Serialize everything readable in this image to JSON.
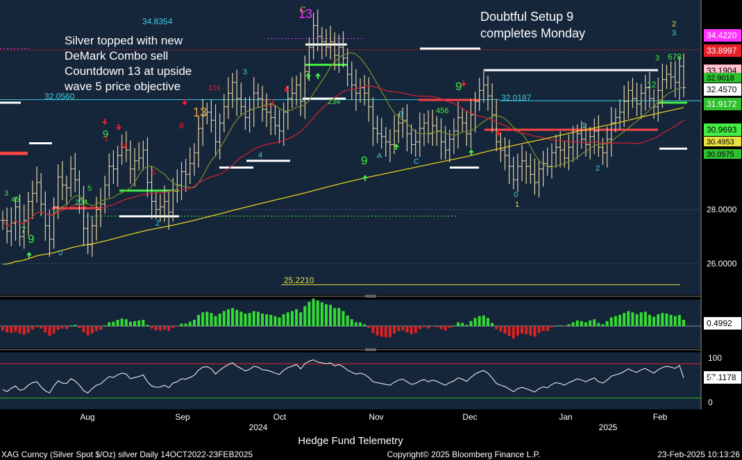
{
  "chart_data": {
    "type": "bar",
    "subtype": "ohlc-price-chart-with-histogram-and-oscillator",
    "background": "#15253a",
    "price_axis": {
      "ticks": [
        26.0,
        28.0
      ],
      "tick_labels": [
        "26.0000",
        "28.0000"
      ],
      "grid": true
    },
    "x_axis": {
      "month_labels": [
        "Aug",
        "Sep",
        "Oct",
        "Nov",
        "Dec",
        "Jan",
        "Feb"
      ],
      "year_labels": [
        "2024",
        "2025"
      ]
    },
    "annotations": {
      "left_text": [
        "Silver topped with new",
        "DeMark Combo sell",
        "Countdown 13 at upside",
        "wave 5 price objective"
      ],
      "right_text": [
        "Doubtful Setup 9",
        "completes Monday"
      ],
      "level_labels": [
        "34.8354",
        "32.0560",
        "32.0187",
        "25.2210"
      ]
    },
    "price_tags": [
      {
        "value": "34.4220",
        "color": "#ff33ff"
      },
      {
        "value": "33.8997",
        "color": "#e8202a"
      },
      {
        "value": "33.1904",
        "color": "#ffc0d0"
      },
      {
        "value": "32.4570",
        "color": "#ffffff"
      },
      {
        "value": "31.9172",
        "color": "#2fbf2f"
      },
      {
        "value": "30.9693",
        "color": "#44ee44"
      }
    ],
    "overlapped_tags": [
      "32.9018",
      "30.4953",
      "30.0575"
    ],
    "histogram": {
      "tag": "0.4992",
      "positive_color": "#33dd33",
      "negative_color": "#dd2222"
    },
    "oscillator": {
      "ticks": [
        "100",
        "50",
        "0"
      ],
      "tag": "57.1178",
      "upper_band": 90,
      "lower_band": 10
    },
    "series": [
      {
        "name": "close",
        "color": "#ffffff"
      },
      {
        "name": "ma-short",
        "color": "#7a8a2a"
      },
      {
        "name": "ma-mid",
        "color": "#cc2233"
      },
      {
        "name": "ma-long",
        "color": "#e8d020"
      }
    ],
    "close_series": [
      27.6,
      27.2,
      27.5,
      28.1,
      27.0,
      27.6,
      28.3,
      28.6,
      29.0,
      28.2,
      27.4,
      26.9,
      28.1,
      29.2,
      28.9,
      28.8,
      29.5,
      29.1,
      28.4,
      27.3,
      26.7,
      27.4,
      28.0,
      28.2,
      28.9,
      29.6,
      29.5,
      30.0,
      30.3,
      30.2,
      29.5,
      29.8,
      29.9,
      30.2,
      29.0,
      28.3,
      28.0,
      28.1,
      28.3,
      27.9,
      28.7,
      28.9,
      29.4,
      29.3,
      29.7,
      30.1,
      31.0,
      31.5,
      31.6,
      31.3,
      30.5,
      31.2,
      31.8,
      32.3,
      32.7,
      32.1,
      31.8,
      31.4,
      31.7,
      32.3,
      32.1,
      31.7,
      31.6,
      31.4,
      31.1,
      30.9,
      31.6,
      32.1,
      32.3,
      32.6,
      32.0,
      33.1,
      34.0,
      34.8,
      34.4,
      34.2,
      34.0,
      34.2,
      33.7,
      34.0,
      33.6,
      33.0,
      32.6,
      32.3,
      32.5,
      32.3,
      31.8,
      31.0,
      30.8,
      30.7,
      30.5,
      30.4,
      30.9,
      31.2,
      31.3,
      30.8,
      30.4,
      30.5,
      31.0,
      31.2,
      30.8,
      31.1,
      30.9,
      30.5,
      30.2,
      30.6,
      30.9,
      31.4,
      31.2,
      30.8,
      31.5,
      32.0,
      32.4,
      32.6,
      32.2,
      31.5,
      30.5,
      30.2,
      30.0,
      29.6,
      29.1,
      29.6,
      29.8,
      29.6,
      29.3,
      29.0,
      29.5,
      29.7,
      29.6,
      30.1,
      30.3,
      30.2,
      29.9,
      30.3,
      30.5,
      30.8,
      30.6,
      30.4,
      30.7,
      30.9,
      30.3,
      30.1,
      30.6,
      31.2,
      31.4,
      31.6,
      32.0,
      32.4,
      32.1,
      31.9,
      32.3,
      32.5,
      32.1,
      31.8,
      32.4,
      32.8,
      33.0,
      32.9,
      32.7,
      33.3,
      32.5
    ],
    "oscillator_series": [
      30,
      25,
      33,
      38,
      28,
      31,
      40,
      46,
      48,
      36,
      27,
      22,
      38,
      50,
      45,
      44,
      55,
      50,
      40,
      27,
      22,
      32,
      40,
      43,
      52,
      60,
      58,
      64,
      68,
      66,
      55,
      58,
      60,
      64,
      48,
      38,
      35,
      36,
      40,
      34,
      45,
      48,
      55,
      54,
      58,
      63,
      75,
      82,
      83,
      78,
      66,
      75,
      82,
      88,
      92,
      84,
      79,
      73,
      77,
      84,
      82,
      76,
      75,
      72,
      68,
      65,
      75,
      81,
      84,
      88,
      78,
      90,
      96,
      99,
      94,
      92,
      90,
      92,
      85,
      88,
      83,
      75,
      70,
      66,
      68,
      65,
      58,
      48,
      46,
      44,
      42,
      40,
      47,
      52,
      54,
      48,
      42,
      44,
      50,
      53,
      48,
      52,
      49,
      44,
      40,
      46,
      50,
      57,
      54,
      49,
      58,
      66,
      71,
      74,
      68,
      57,
      44,
      40,
      37,
      31,
      25,
      32,
      35,
      32,
      28,
      24,
      32,
      36,
      34,
      42,
      46,
      44,
      40,
      46,
      50,
      55,
      52,
      48,
      53,
      57,
      48,
      45,
      52,
      61,
      64,
      67,
      72,
      78,
      73,
      70,
      76,
      79,
      73,
      68,
      76,
      81,
      84,
      82,
      79,
      86,
      57
    ],
    "histogram_series": [
      -0.35,
      -0.5,
      -0.55,
      -0.45,
      -0.6,
      -0.7,
      -0.55,
      -0.3,
      -0.1,
      -0.2,
      -0.5,
      -0.8,
      -0.6,
      -0.3,
      -0.2,
      -0.25,
      0.05,
      0.1,
      -0.15,
      -0.5,
      -0.75,
      -0.6,
      -0.4,
      -0.3,
      0.05,
      0.3,
      0.35,
      0.5,
      0.6,
      0.55,
      0.35,
      0.4,
      0.45,
      0.5,
      0.1,
      -0.2,
      -0.35,
      -0.35,
      -0.3,
      -0.4,
      -0.15,
      -0.05,
      0.2,
      0.2,
      0.35,
      0.5,
      0.9,
      1.1,
      1.15,
      1.05,
      0.8,
      1.0,
      1.2,
      1.35,
      1.45,
      1.3,
      1.15,
      1.0,
      1.05,
      1.2,
      1.15,
      1.0,
      0.95,
      0.9,
      0.8,
      0.7,
      0.95,
      1.1,
      1.2,
      1.35,
      1.1,
      1.6,
      1.95,
      2.2,
      2.05,
      1.9,
      1.75,
      1.7,
      1.45,
      1.45,
      1.2,
      0.85,
      0.55,
      0.3,
      0.3,
      0.15,
      -0.15,
      -0.55,
      -0.75,
      -0.85,
      -0.9,
      -0.9,
      -0.6,
      -0.4,
      -0.35,
      -0.5,
      -0.65,
      -0.55,
      -0.25,
      -0.1,
      -0.2,
      -0.05,
      -0.1,
      -0.25,
      -0.35,
      -0.15,
      0.05,
      0.3,
      0.25,
      0.1,
      0.4,
      0.65,
      0.8,
      0.85,
      0.65,
      0.25,
      -0.25,
      -0.45,
      -0.6,
      -0.8,
      -1.0,
      -0.75,
      -0.6,
      -0.65,
      -0.75,
      -0.85,
      -0.55,
      -0.4,
      -0.4,
      -0.1,
      0.05,
      0.05,
      -0.05,
      0.15,
      0.3,
      0.45,
      0.4,
      0.3,
      0.45,
      0.55,
      0.25,
      0.15,
      0.4,
      0.7,
      0.8,
      0.9,
      1.05,
      1.2,
      1.1,
      0.95,
      1.1,
      1.15,
      0.9,
      0.75,
      0.95,
      1.05,
      1.0,
      0.9,
      0.8,
      0.9,
      0.5
    ]
  },
  "footer": {
    "source": "XAG Curncy (Silver Spot $/Oz) silver  Daily 14OCT2022-23FEB2025",
    "title": "Hedge Fund Telemetry",
    "copyright": "Copyright© 2025 Bloomberg Finance L.P.",
    "timestamp": "23-Feb-2025 10:13:26"
  }
}
